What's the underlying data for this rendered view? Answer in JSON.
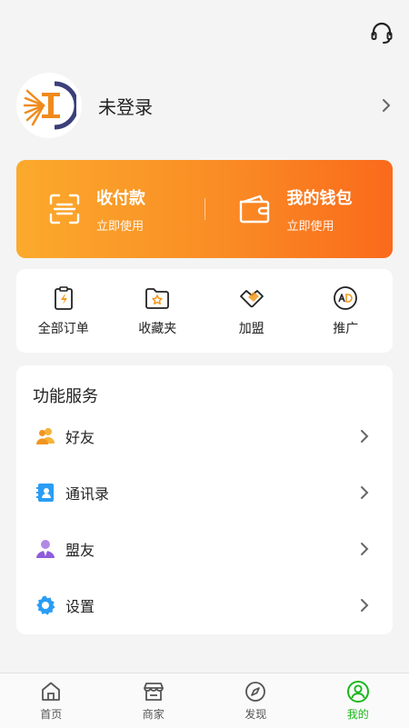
{
  "profile": {
    "name": "未登录"
  },
  "pay_card": {
    "collect": {
      "title": "收付款",
      "sub": "立即使用"
    },
    "wallet": {
      "title": "我的钱包",
      "sub": "立即使用"
    }
  },
  "quick_actions": [
    {
      "label": "全部订单",
      "icon": "order-icon"
    },
    {
      "label": "收藏夹",
      "icon": "favorites-folder-icon"
    },
    {
      "label": "加盟",
      "icon": "handshake-icon"
    },
    {
      "label": "推广",
      "icon": "ad-icon"
    }
  ],
  "services": {
    "title": "功能服务",
    "items": [
      {
        "label": "好友",
        "icon": "friends-icon"
      },
      {
        "label": "通讯录",
        "icon": "contacts-icon"
      },
      {
        "label": "盟友",
        "icon": "ally-icon"
      },
      {
        "label": "设置",
        "icon": "settings-gear-icon"
      }
    ]
  },
  "tabbar": {
    "items": [
      {
        "label": "首页",
        "icon": "home-icon"
      },
      {
        "label": "商家",
        "icon": "store-icon"
      },
      {
        "label": "发现",
        "icon": "compass-icon"
      },
      {
        "label": "我的",
        "icon": "user-icon"
      }
    ],
    "active_index": 3
  },
  "colors": {
    "accent": "#fa8c25",
    "tab_active": "#1db71d"
  }
}
